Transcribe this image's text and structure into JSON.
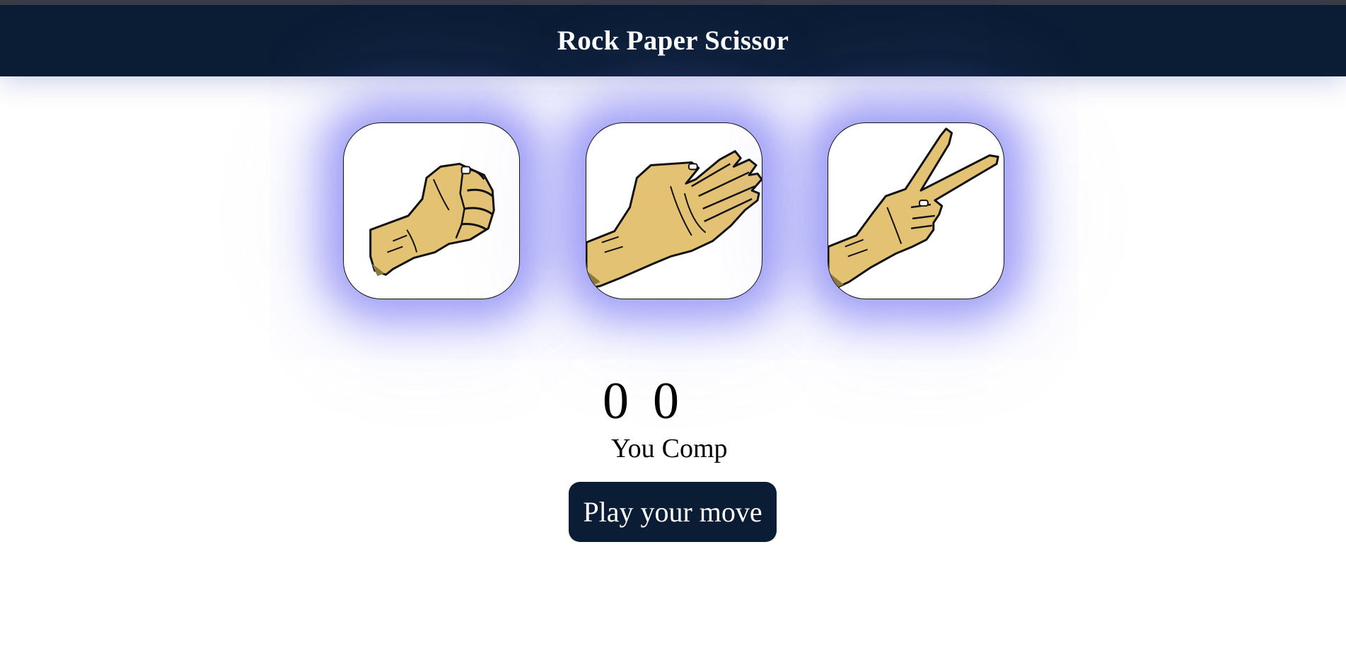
{
  "header": {
    "title": "Rock Paper Scissor"
  },
  "choices": [
    {
      "id": "rock",
      "icon": "rock-hand-icon"
    },
    {
      "id": "paper",
      "icon": "paper-hand-icon"
    },
    {
      "id": "scissor",
      "icon": "scissor-hand-icon"
    }
  ],
  "scoreboard": {
    "user_score": "0",
    "comp_score": "0",
    "user_label": "You",
    "comp_label": "Comp"
  },
  "message": {
    "text": "Play your move"
  },
  "colors": {
    "header_bg": "#0b1d35",
    "glow": "#5a5af0",
    "skin": "#e4c274"
  }
}
